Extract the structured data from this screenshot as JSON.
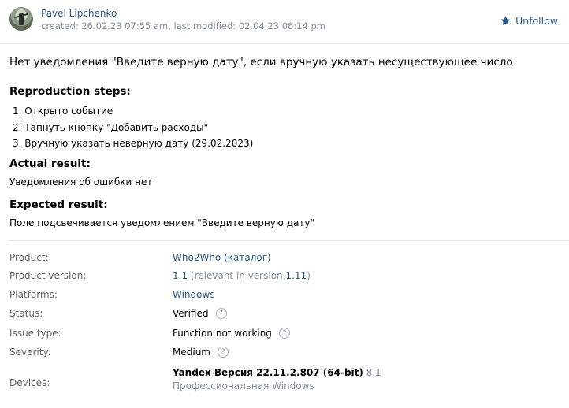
{
  "header": {
    "author": "Pavel Lipchenko",
    "meta": "created: 26.02.23 07:55 am, last modified: 02.04.23 06:14 pm",
    "unfollow_label": "Unfollow"
  },
  "report": {
    "title": "Нет уведомления \"Введите верную дату\", если вручную указать несуществующее число",
    "steps_heading": "Reproduction steps:",
    "steps": [
      "1. Открыто событие",
      "2. Тапнуть кнопку \"Добавить расходы\"",
      "3. Вручную указать неверную дату (29.02.2023)"
    ],
    "actual_heading": "Actual result:",
    "actual_text": "Уведомления об ошибки нет",
    "expected_heading": "Expected result:",
    "expected_text": "Поле подсвечивается уведомлением \"Введите верную дату\""
  },
  "props": {
    "product": {
      "label": "Product:",
      "value": "Who2Who (каталог)"
    },
    "version": {
      "label": "Product version:",
      "value": "1.1",
      "note_prefix": " (relevant in version ",
      "note_version": "1.11",
      "note_suffix": ")"
    },
    "platforms": {
      "label": "Platforms:",
      "value": "Windows"
    },
    "status": {
      "label": "Status:",
      "value": "Verified",
      "help": "?"
    },
    "issue_type": {
      "label": "Issue type:",
      "value": "Function not working",
      "help": "?"
    },
    "severity": {
      "label": "Severity:",
      "value": "Medium",
      "help": "?"
    },
    "devices": {
      "label": "Devices:",
      "device_name": "Yandex Версия 22.11.2.807 (64-bit)",
      "device_os": " 8.1 Профессиональная Windows"
    }
  },
  "colors": {
    "link": "#2a5885",
    "muted": "#818c99",
    "star": "#2a5885"
  },
  "icons": {
    "unfollow": "star-icon",
    "help": "question-circle-icon"
  }
}
